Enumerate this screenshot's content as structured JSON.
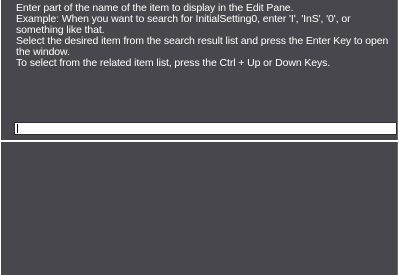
{
  "instructions": {
    "line1": "Enter part of the name of the item to display in the Edit Pane.",
    "line2": "Example: When you want to search for InitialSetting0, enter 'I', 'InS', '0', or something like that.",
    "line3": "Select the desired item from the search result list and press the Enter Key to open the window.",
    "line4": "To select from the related item list, press the Ctrl + Up or Down Keys."
  },
  "search": {
    "value": "",
    "placeholder": ""
  },
  "colors": {
    "panel_bg": "#48474d",
    "text": "#ffffff",
    "input_bg": "#ffffff"
  }
}
